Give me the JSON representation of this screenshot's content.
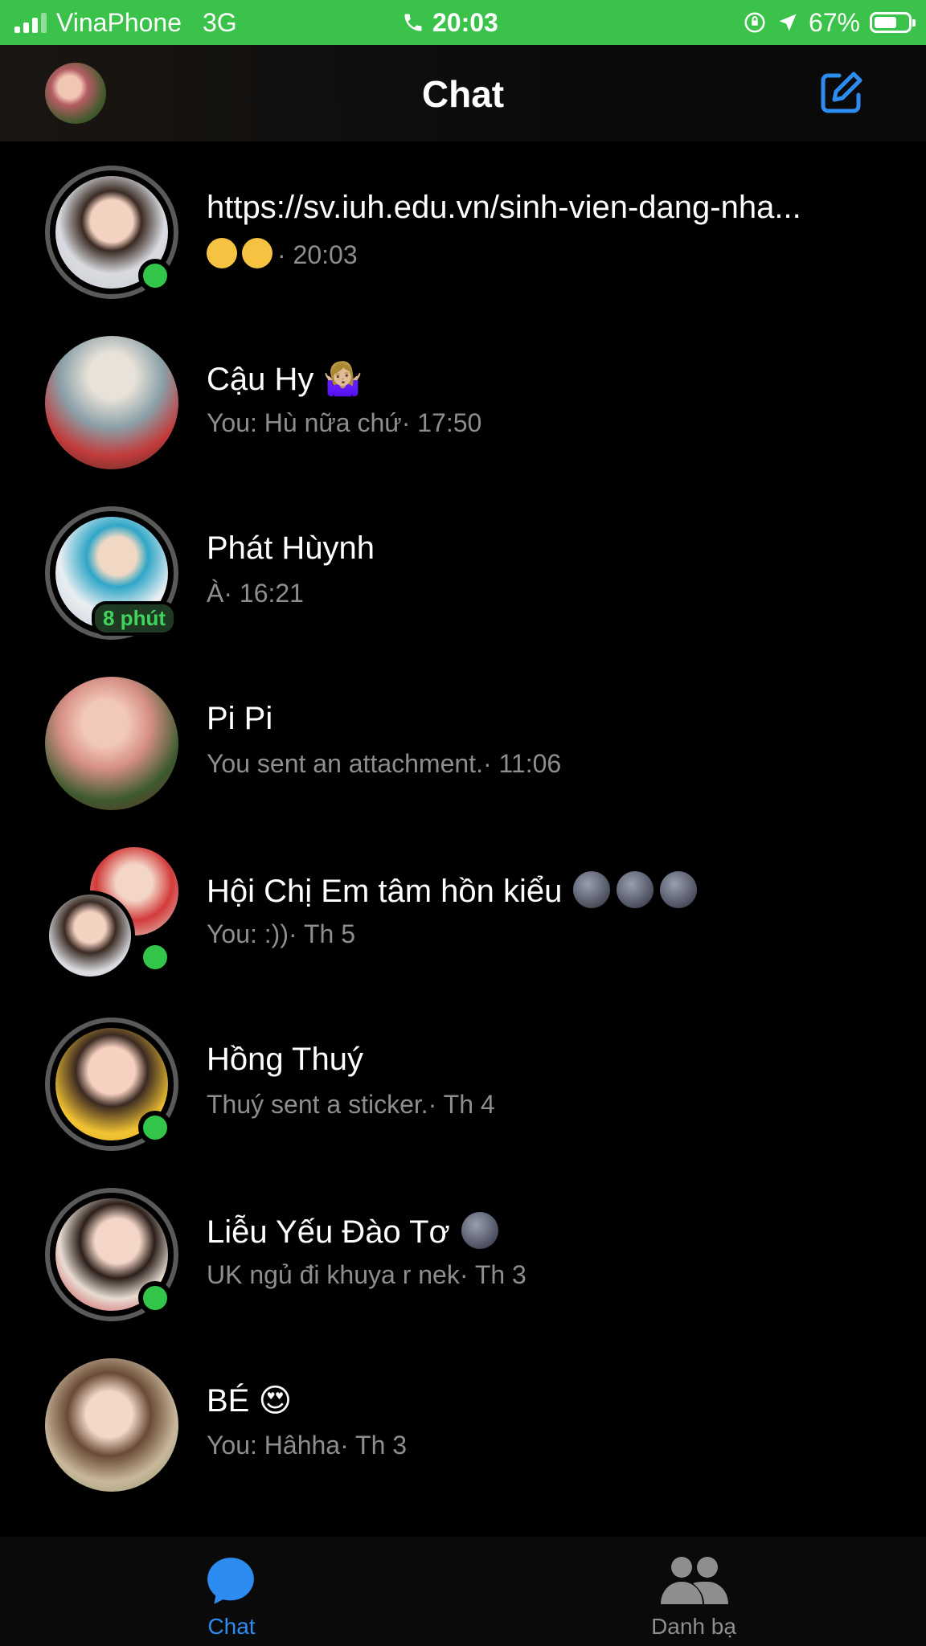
{
  "status_bar": {
    "carrier": "VinaPhone",
    "network": "3G",
    "time": "20:03",
    "battery": "67%",
    "battery_level": 0.67
  },
  "header": {
    "title": "Chat",
    "avatar_icon": "profile-avatar",
    "compose_icon": "compose-icon"
  },
  "conversations": [
    {
      "name": "https://sv.iuh.edu.vn/sinh-vien-dang-nha...",
      "preview": "· 20:03",
      "preview_emoji": "grimacing-face x2",
      "online": true
    },
    {
      "name": "Cậu Hy 🤷🏼‍♀️",
      "preview": "You: Hù nữa chứ· 17:50",
      "online": false
    },
    {
      "name": "Phát Hùynh",
      "preview": "À· 16:21",
      "active_ago": "8 phút"
    },
    {
      "name": "Pi Pi",
      "preview": "You sent an attachment.· 11:06",
      "online": false
    },
    {
      "name": "Hội Chị Em tâm hồn kiểu",
      "name_emoji": "new-moon-face x3",
      "preview": "You: :))· Th 5",
      "online": true
    },
    {
      "name": "Hồng Thuý",
      "preview": "Thuý sent a sticker.· Th 4",
      "online": true
    },
    {
      "name": "Liễu Yếu Đào Tơ",
      "name_emoji": "new-moon-face",
      "preview": "UK ngủ đi khuya r nek· Th 3",
      "online": true
    },
    {
      "name": "BÉ 😍",
      "preview": "You: Hâhha· Th 3",
      "online": false
    }
  ],
  "tabs": [
    {
      "label": "Chat",
      "icon": "chat-bubble-icon",
      "active": true
    },
    {
      "label": "Danh bạ",
      "icon": "people-icon",
      "active": false
    }
  ],
  "colors": {
    "status_bar": "#3ac24a",
    "accent": "#2d8cf0",
    "online": "#33c44a",
    "secondary_text": "#8e8e8e"
  }
}
